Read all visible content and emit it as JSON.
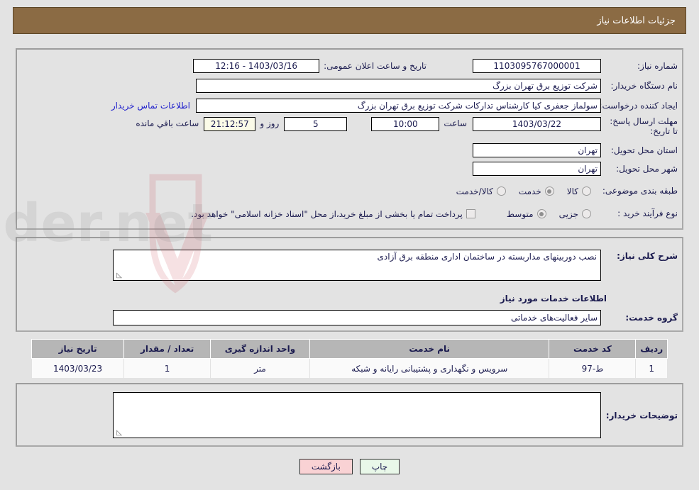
{
  "header": {
    "title": "جزئیات اطلاعات نیاز"
  },
  "form": {
    "need_number_label": "شماره نیاز:",
    "need_number_value": "1103095767000001",
    "announce_datetime_label": "تاریخ و ساعت اعلان عمومی:",
    "announce_datetime_value": "1403/03/16 - 12:16",
    "buyer_org_label": "نام دستگاه خریدار:",
    "buyer_org_value": "شرکت توزیع برق تهران بزرگ",
    "buyer_org_value2": "",
    "creator_label": "ایجاد کننده درخواست:",
    "creator_value": "سولماز جعفری کیا کارشناس تدارکات شرکت توزیع برق تهران بزرگ",
    "creator_value2": "شرکت توزیع برق تهران بزرگ",
    "contact_link": "اطلاعات تماس خریدار",
    "deadline_label": "مهلت ارسال پاسخ: تا تاریخ:",
    "deadline_date": "1403/03/22",
    "deadline_hour_label": "ساعت",
    "deadline_hour": "10:00",
    "days_remaining": "5",
    "days_unit": "روز و",
    "time_remaining": "21:12:57",
    "time_remaining_suffix": "ساعت باقي مانده",
    "province_label": "استان محل تحویل:",
    "province_value": "تهران",
    "city_label": "شهر محل تحویل:",
    "city_value": "تهران",
    "category_label": "طبقه بندی موضوعی:",
    "category_options": [
      {
        "label": "کالا",
        "selected": false
      },
      {
        "label": "خدمت",
        "selected": true
      },
      {
        "label": "کالا/خدمت",
        "selected": false
      }
    ],
    "process_label": "نوع فرآیند خرید :",
    "process_options": [
      {
        "label": "جزیی",
        "selected": false
      },
      {
        "label": "متوسط",
        "selected": true
      }
    ],
    "treasury_checkbox_label": "پرداخت تمام یا بخشی از مبلغ خرید،از محل \"اسناد خزانه اسلامی\" خواهد بود.",
    "treasury_checked": false
  },
  "description": {
    "label": "شرح کلی نیاز:",
    "value": "نصب دوربینهای مداربسته در ساختمان اداری منطقه برق آزادی"
  },
  "services_section": {
    "heading": "اطلاعات خدمات مورد نیاز",
    "group_label": "گروه خدمت:",
    "group_value": "سایر فعالیت‌های خدماتی"
  },
  "items_table": {
    "columns": [
      "ردیف",
      "کد خدمت",
      "نام خدمت",
      "واحد اندازه گیری",
      "تعداد / مقدار",
      "تاریخ نیاز"
    ],
    "rows": [
      {
        "radif": "1",
        "code": "ط-97",
        "name": "سرویس و نگهداری و پشتیبانی رایانه و شبکه",
        "unit": "متر",
        "qty": "1",
        "date": "1403/03/23"
      }
    ]
  },
  "buyer_notes": {
    "label": "توضیحات خریدار:",
    "value": ""
  },
  "footer": {
    "print_label": "چاپ",
    "back_label": "بازگشت"
  },
  "colors": {
    "header_bg": "#8b6b44",
    "page_bg": "#e3e3e3",
    "link": "#2222cc",
    "text": "#1b1b4f",
    "table_header_bg": "#b6b6b6",
    "back_btn_bg": "#f9d2d4",
    "print_btn_bg": "#e9f8e9",
    "timer_bg": "#fbfbe8"
  }
}
